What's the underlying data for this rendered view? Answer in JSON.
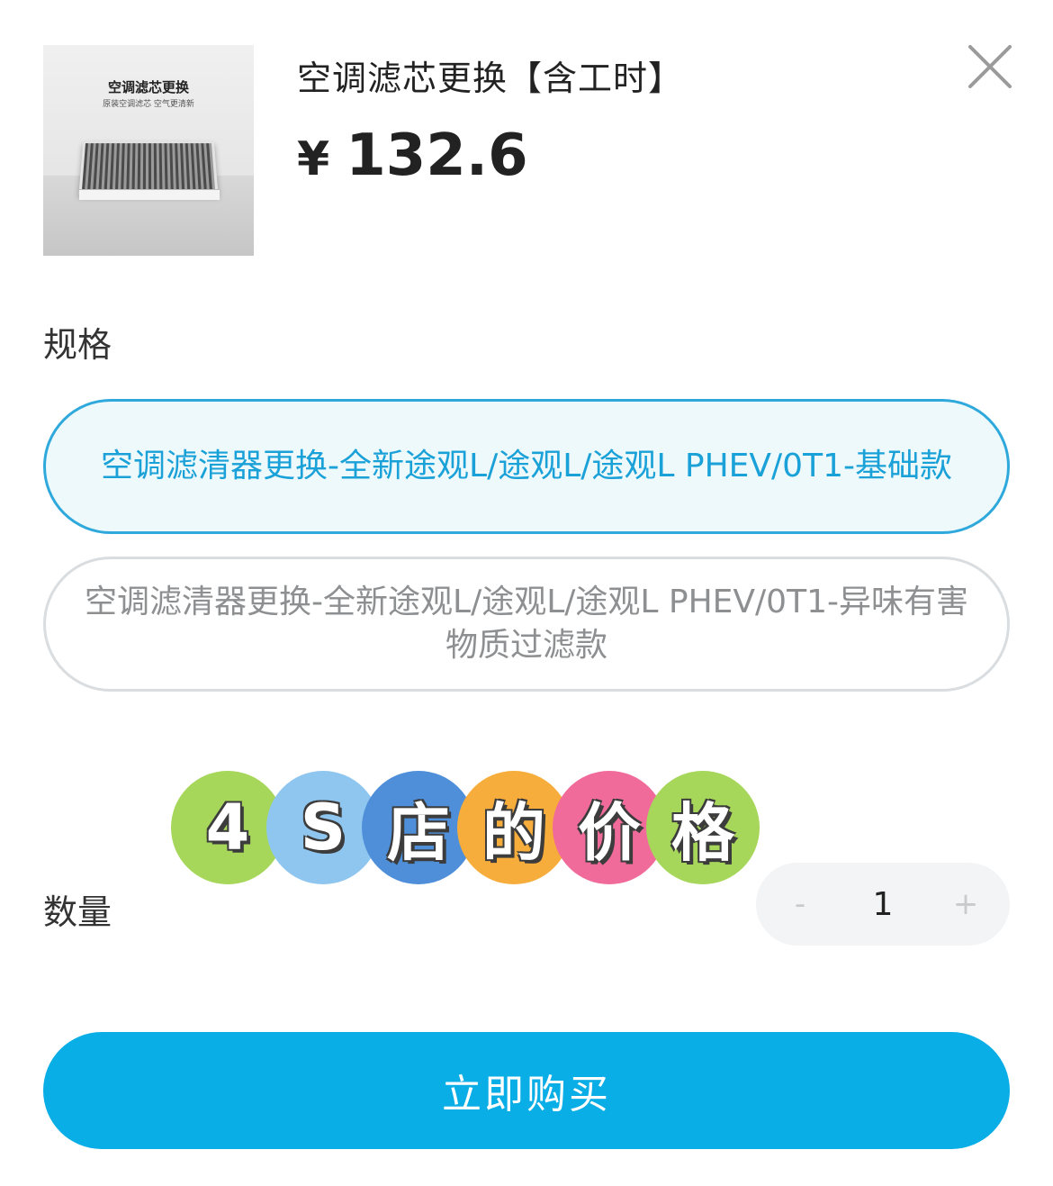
{
  "product": {
    "thumbnail": {
      "headline": "空调滤芯更换",
      "tagline": "原装空调滤芯 空气更清新"
    },
    "title": "空调滤芯更换【含工时】",
    "currency": "¥",
    "price": "132.6"
  },
  "spec_section": {
    "label": "规格",
    "options": [
      {
        "label": "空调滤清器更换-全新途观L/途观L/途观L PHEV/0T1-基础款",
        "selected": true
      },
      {
        "label": "空调滤清器更换-全新途观L/途观L/途观L PHEV/0T1-异味有害物质过滤款",
        "selected": false
      }
    ]
  },
  "sticker": {
    "chars": [
      "4",
      "S",
      "店",
      "的",
      "价",
      "格"
    ],
    "colors": [
      "#a6d65a",
      "#8fc6ef",
      "#4f8fd9",
      "#f7ad3b",
      "#f06b9a",
      "#a6d65a"
    ]
  },
  "quantity_section": {
    "label": "数量",
    "minus": "-",
    "value": "1",
    "plus": "+"
  },
  "buy_button": {
    "label": "立即购买"
  },
  "colors": {
    "accent": "#0aaee6",
    "selected_border": "#2fa9dc",
    "selected_text": "#1aa1d8",
    "selected_bg": "#eef9fc"
  },
  "icons": {
    "close": "close-icon"
  }
}
